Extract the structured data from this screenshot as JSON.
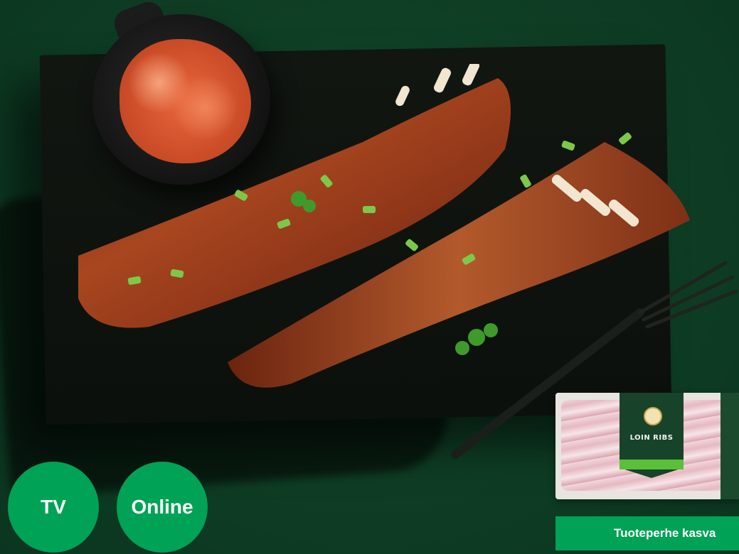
{
  "scene": {
    "board_color": "#0f130f",
    "background_color": "#0f3f25"
  },
  "pack": {
    "label_text": "LOIN RIBS"
  },
  "badges": [
    {
      "label": "TV"
    },
    {
      "label": "Online"
    }
  ],
  "banner": {
    "text": "Tuoteperhe kasva"
  },
  "colors": {
    "accent_green": "#00a256",
    "pack_green": "#17432a"
  }
}
